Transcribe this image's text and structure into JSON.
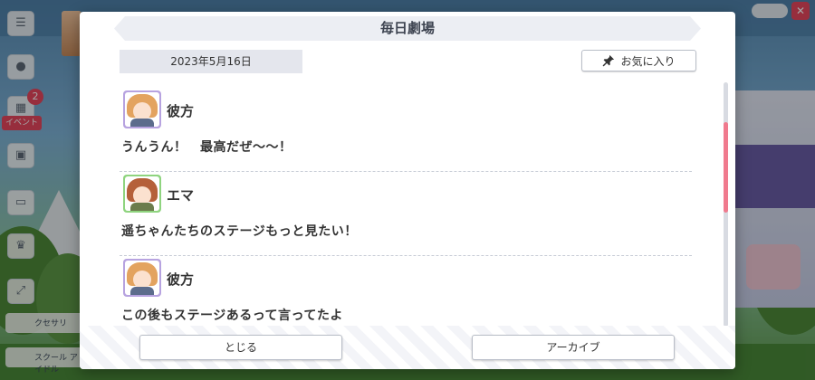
{
  "dialog": {
    "title": "毎日劇場",
    "date": "2023年5月16日",
    "favorite_label": "お気に入り",
    "close_label": "とじる",
    "archive_label": "アーカイブ"
  },
  "messages": [
    {
      "speaker": "彼方",
      "text": "うんうん！　最高だぜ〜〜！",
      "avatar_color": "#b7a3e0",
      "hair_color": "#e3a35f"
    },
    {
      "speaker": "エマ",
      "text": "遥ちゃんたちのステージもっと見たい！",
      "avatar_color": "#8fd47f",
      "hair_color": "#b5603a"
    },
    {
      "speaker": "彼方",
      "text": "この後もステージあるって言ってたよ",
      "avatar_color": "#b7a3e0",
      "hair_color": "#e3a35f"
    }
  ],
  "background": {
    "notification_count": "2",
    "event_label": "イベント",
    "side_labels": [
      "クセサリ",
      "スクール\nアイドル"
    ]
  },
  "colors": {
    "accent": "#f07a8e",
    "badge": "#e8475e"
  },
  "icons": {
    "favorite": "pin-icon"
  }
}
